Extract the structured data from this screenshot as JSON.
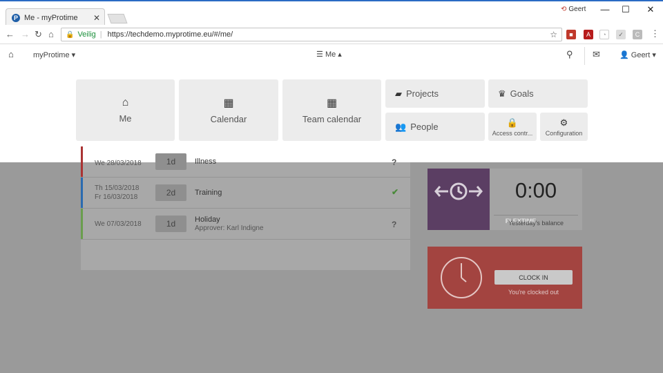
{
  "browser": {
    "tab_title": "Me - myProtime",
    "window_user": "Geert",
    "url_secure_label": "Veilig",
    "url": "https://techdemo.myprotime.eu/#/me/"
  },
  "appnav": {
    "brand": "myProtime",
    "menu_label": "Me",
    "user_label": "Geert"
  },
  "menu": {
    "me": "Me",
    "calendar": "Calendar",
    "team_calendar": "Team calendar",
    "projects": "Projects",
    "goals": "Goals",
    "people": "People",
    "access_control": "Access contr...",
    "configuration": "Configuration"
  },
  "list": {
    "rows": [
      {
        "date1": "We 28/03/2018",
        "date2": "",
        "days": "1d",
        "title": "Illness",
        "sub": "",
        "status": "?",
        "color": "#a33"
      },
      {
        "date1": "Th 15/03/2018",
        "date2": "Fr 16/03/2018",
        "days": "2d",
        "title": "Training",
        "sub": "",
        "status": "✔",
        "color": "#2a6bb0"
      },
      {
        "date1": "We 07/03/2018",
        "date2": "",
        "days": "1d",
        "title": "Holiday",
        "sub": "Approver: Karl Indigne",
        "status": "?",
        "color": "#6a9e4d"
      }
    ]
  },
  "flextime": {
    "label": "FLEXTIME",
    "value": "0:00",
    "subtitle": "Yesterday's balance"
  },
  "clock": {
    "button_label": "CLOCK IN",
    "status": "You're clocked out"
  }
}
